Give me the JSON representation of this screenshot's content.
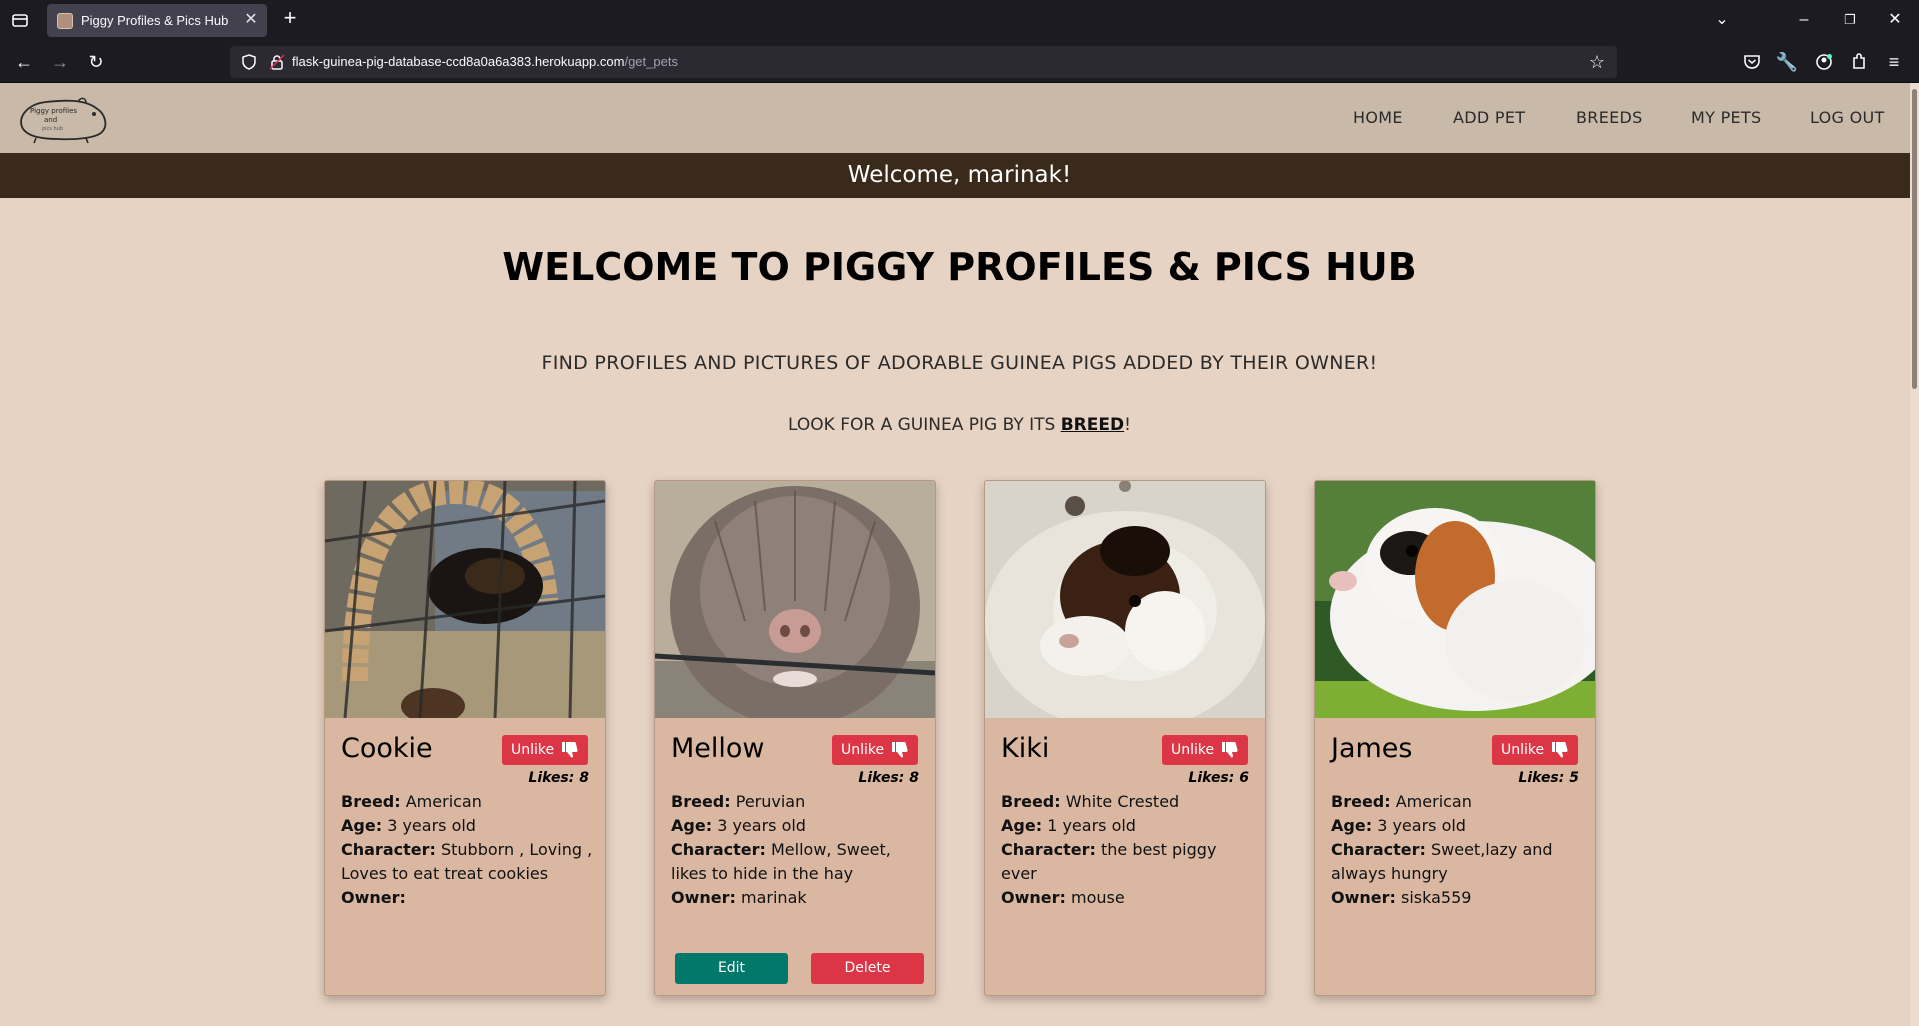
{
  "browser": {
    "tab_title": "Piggy Profiles & Pics Hub",
    "url_host": "flask-guinea-pig-database-ccd8a0a6a383.herokuapp.com",
    "url_path": "/get_pets"
  },
  "site": {
    "logo_text_line1": "Piggy profiles",
    "logo_text_line2": "and",
    "logo_text_line3": "pics hub",
    "menu": {
      "home": "HOME",
      "add_pet": "ADD PET",
      "breeds": "BREEDS",
      "my_pets": "MY PETS",
      "log_out": "LOG OUT"
    },
    "banner": "Welcome, marinak!",
    "heading": "WELCOME TO PIGGY PROFILES & PICS HUB",
    "subheading": "FIND PROFILES AND PICTURES OF ADORABLE GUINEA PIGS ADDED BY THEIR OWNER!",
    "breed_prompt_before": "LOOK FOR A GUINEA PIG BY ITS ",
    "breed_link": "BREED",
    "breed_prompt_after": "!"
  },
  "labels": {
    "breed": "Breed:",
    "age": "Age:",
    "character": "Character:",
    "owner": "Owner:",
    "likes": "Likes:",
    "unlike": "Unlike",
    "edit": "Edit",
    "delete": "Delete"
  },
  "pets": [
    {
      "name": "Cookie",
      "likes": "8",
      "breed": "American",
      "age": "3 years old",
      "character": "Stubborn , Loving , Loves to eat treat cookies",
      "owner": ""
    },
    {
      "name": "Mellow",
      "likes": "8",
      "breed": "Peruvian",
      "age": "3 years old",
      "character": "Mellow, Sweet, likes to hide in the hay",
      "owner": "marinak"
    },
    {
      "name": "Kiki",
      "likes": "6",
      "breed": "White Crested",
      "age": "1 years old",
      "character": "the best piggy ever",
      "owner": "mouse"
    },
    {
      "name": "James",
      "likes": "5",
      "breed": "American",
      "age": "3 years old",
      "character": "Sweet,lazy and always hungry",
      "owner": "siska559"
    }
  ],
  "colors": {
    "page_bg": "#e7d3c3",
    "header_bg": "#c8b9a9",
    "banner_bg": "#3a2a1c",
    "card_bg": "#d9b7a1",
    "unlike_red": "#dc3545",
    "edit_green": "#00796b"
  }
}
